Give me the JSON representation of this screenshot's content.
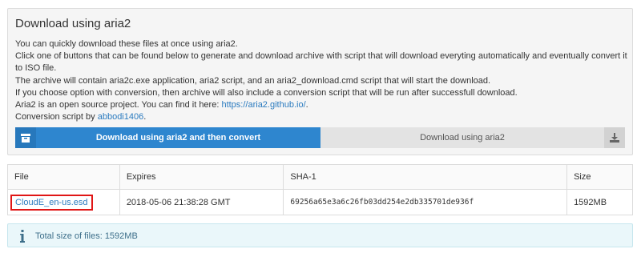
{
  "panel": {
    "title": "Download using aria2",
    "intro_line1": "You can quickly download these files at once using aria2.",
    "intro_line2": "Click one of buttons that can be found below to generate and download archive with script that will download everyting automatically and eventually convert it to ISO file.",
    "archive_line1": "The archive will contain aria2c.exe application, aria2 script, and an aria2_download.cmd script that will start the download.",
    "archive_line2": "If you choose option with conversion, then archive will also include a conversion script that will be run after successfull download.",
    "aria_text": "Aria2 is an open source project. You can find it here: ",
    "aria_link": "https://aria2.github.io/",
    "aria_suffix": ".",
    "conv_text": "Conversion script by ",
    "conv_link": "abbodi1406",
    "conv_suffix": ".",
    "btn_convert": "Download using aria2 and then convert",
    "btn_download": "Download using aria2",
    "btn_convert_icon": "archive-icon",
    "btn_download_icon": "download-icon"
  },
  "table": {
    "headers": [
      "File",
      "Expires",
      "SHA-1",
      "Size"
    ],
    "rows": [
      {
        "file": "CloudE_en-us.esd",
        "expires": "2018-05-06 21:38:28 GMT",
        "sha1": "69256a65e3a6c26fb03dd254e2db335701de936f",
        "size": "1592MB"
      }
    ]
  },
  "info": {
    "icon": "info-icon",
    "text": "Total size of files: 1592MB"
  },
  "colors": {
    "primary": "#2e86cf",
    "link": "#2b7bbf",
    "highlight": "#e01616",
    "info_bg": "#eaf7fa"
  }
}
